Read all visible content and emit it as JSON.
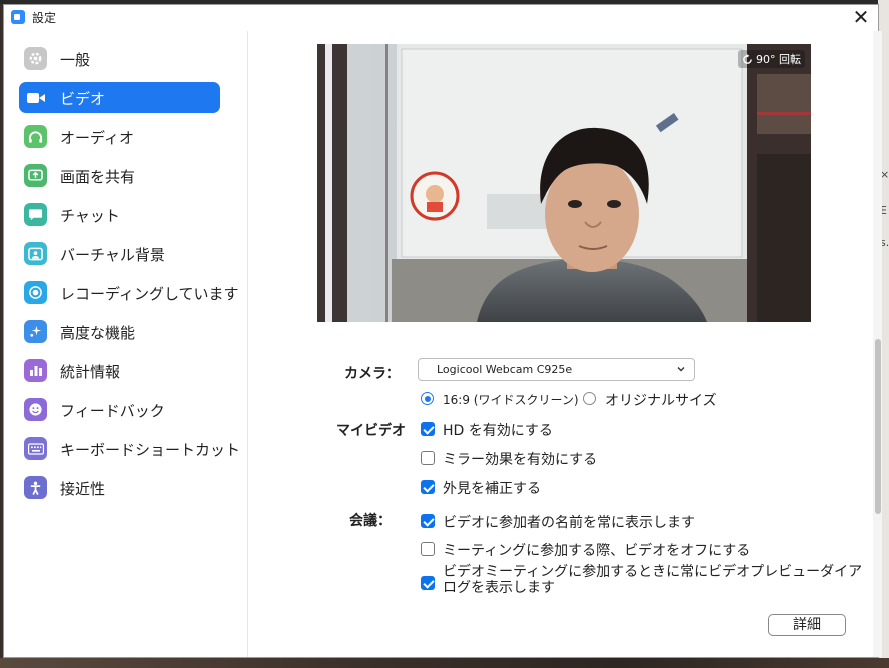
{
  "window": {
    "title": "設定",
    "close_glyph": "✕"
  },
  "sidebar": {
    "items": [
      {
        "label": "一般",
        "icon": "gear-icon",
        "color": "#c8c8c8",
        "active": false
      },
      {
        "label": "ビデオ",
        "icon": "video-camera-icon",
        "color": "#1e78f0",
        "active": true
      },
      {
        "label": "オーディオ",
        "icon": "headphones-icon",
        "color": "#5cc36a",
        "active": false
      },
      {
        "label": "画面を共有",
        "icon": "share-screen-icon",
        "color": "#4bb86e",
        "active": false
      },
      {
        "label": "チャット",
        "icon": "chat-bubble-icon",
        "color": "#3bb6a0",
        "active": false
      },
      {
        "label": "バーチャル背景",
        "icon": "virtual-background-icon",
        "color": "#3bb9d0",
        "active": false
      },
      {
        "label": "レコーディングしています",
        "icon": "record-icon",
        "color": "#2aa8e6",
        "active": false
      },
      {
        "label": "高度な機能",
        "icon": "sparkle-icon",
        "color": "#3d8ee8",
        "active": false
      },
      {
        "label": "統計情報",
        "icon": "statistics-icon",
        "color": "#9b6ad6",
        "active": false
      },
      {
        "label": "フィードバック",
        "icon": "smiley-icon",
        "color": "#8c6ad8",
        "active": false
      },
      {
        "label": "キーボードショートカット",
        "icon": "keyboard-icon",
        "color": "#7b72d6",
        "active": false
      },
      {
        "label": "接近性",
        "icon": "accessibility-icon",
        "color": "#6d6fd0",
        "active": false
      }
    ]
  },
  "video": {
    "rotate_label": "90° 回転",
    "camera_label": "カメラ：",
    "camera_value": "Logicool Webcam C925e",
    "aspect_169_label": "16:9 (ワイドスクリーン)",
    "aspect_original_label": "オリジナルサイズ",
    "aspect_selected": "16:9",
    "my_video_label": "マイビデオ",
    "meeting_label": "会議：",
    "options": [
      {
        "label": "HD を有効にする",
        "checked": true
      },
      {
        "label": "ミラー効果を有効にする",
        "checked": false
      },
      {
        "label": "外見を補正する",
        "checked": true
      },
      {
        "label": "ビデオに参加者の名前を常に表示します",
        "checked": true
      },
      {
        "label": "ミーティングに参加する際、ビデオをオフにする",
        "checked": false
      },
      {
        "label": "ビデオミーティングに参加するときに常にビデオプレビューダイアログを表示します",
        "checked": true
      }
    ],
    "detail_button": "詳細"
  },
  "desktop": {
    "right_fragments": [
      "×",
      "E",
      "s.I"
    ]
  },
  "colors": {
    "accent": "#1e78f0",
    "checkbox": "#0e72ed"
  }
}
